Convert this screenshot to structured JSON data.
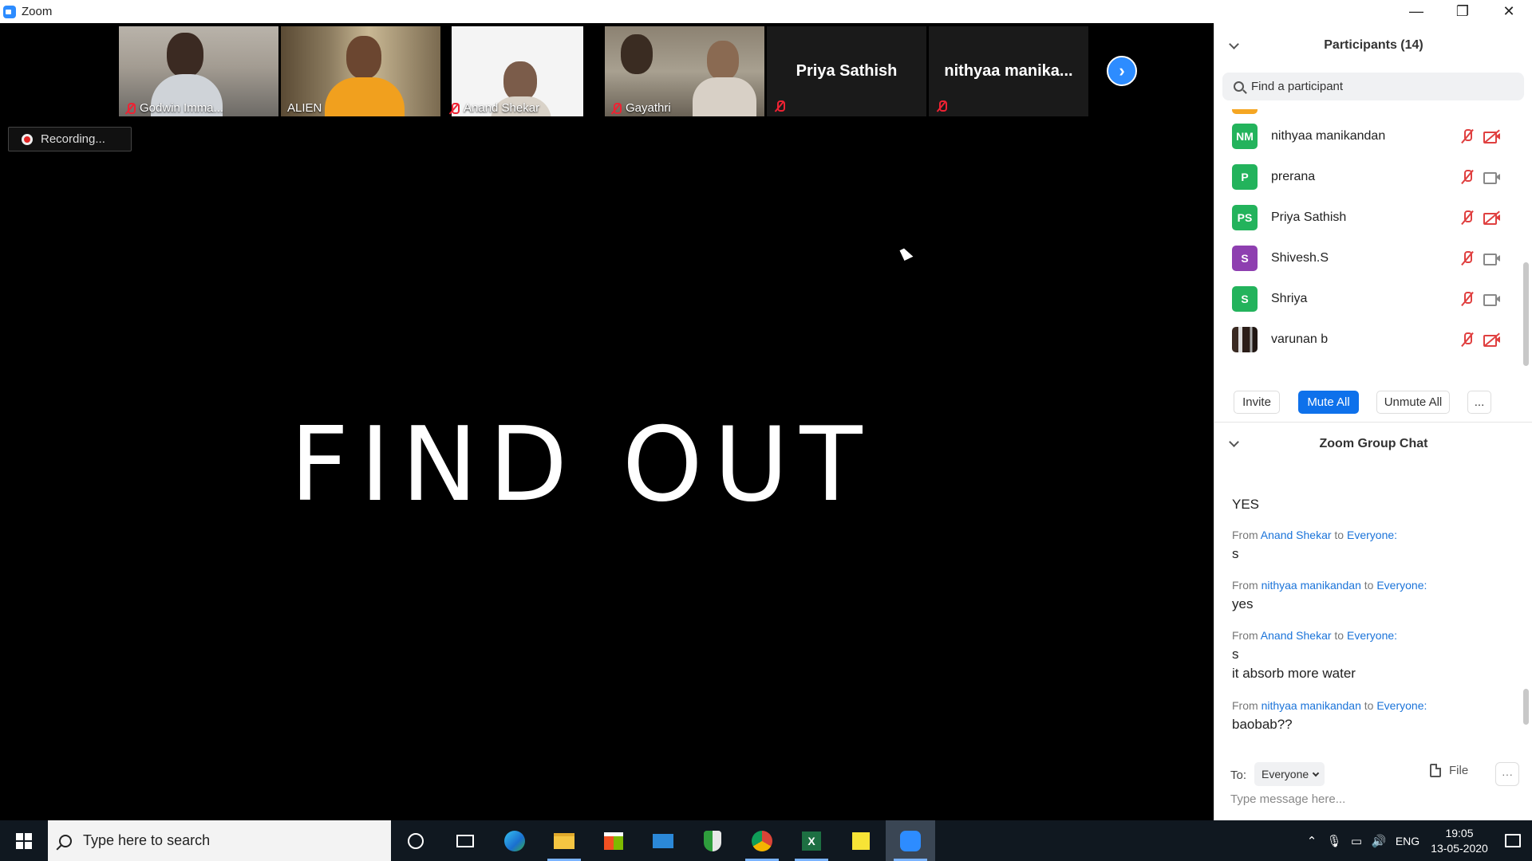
{
  "window": {
    "title": "Zoom",
    "minimize": "—",
    "maximize": "❐",
    "close": "✕"
  },
  "stage": {
    "thumbnails": [
      {
        "name": "Godwin Imma...",
        "muted": true,
        "video": true
      },
      {
        "name": "ALIEN",
        "muted": false,
        "video": true,
        "active": true
      },
      {
        "name": "Anand Shekar",
        "muted": true,
        "video": true
      },
      {
        "name": "Gayathri",
        "muted": true,
        "video": true
      },
      {
        "name": "Priya Sathish",
        "muted": true,
        "video": false
      },
      {
        "name": "nithyaa  manika...",
        "muted": true,
        "video": false
      }
    ],
    "next_label": "›",
    "recording_label": "Recording...",
    "share_text": "FIND OUT"
  },
  "participants": {
    "title": "Participants (14)",
    "search_placeholder": "Find a participant",
    "items": [
      {
        "initials": "NM",
        "name": "nithyaa manikandan",
        "color": "#23b35c",
        "mic_muted": true,
        "video_off": true
      },
      {
        "initials": "P",
        "name": "prerana",
        "color": "#23b35c",
        "mic_muted": true,
        "video_off": false
      },
      {
        "initials": "PS",
        "name": "Priya Sathish",
        "color": "#23b35c",
        "mic_muted": true,
        "video_off": true
      },
      {
        "initials": "S",
        "name": "Shivesh.S",
        "color": "#8e3fb0",
        "mic_muted": true,
        "video_off": false
      },
      {
        "initials": "S",
        "name": "Shriya",
        "color": "#23b35c",
        "mic_muted": true,
        "video_off": false
      },
      {
        "initials": "",
        "name": "varunan b",
        "color": "#333333",
        "mic_muted": true,
        "video_off": true,
        "photo": true
      }
    ],
    "buttons": {
      "invite": "Invite",
      "mute_all": "Mute All",
      "unmute_all": "Unmute All",
      "more": "..."
    }
  },
  "chat": {
    "title": "Zoom Group Chat",
    "partial_top": "YES",
    "messages": [
      {
        "from": "Anand Shekar",
        "to": "Everyone:",
        "lines": [
          "s"
        ]
      },
      {
        "from": "nithyaa manikandan",
        "to": "Everyone:",
        "lines": [
          "yes"
        ]
      },
      {
        "from": "Anand Shekar",
        "to": "Everyone:",
        "lines": [
          "s",
          "it absorb more water"
        ]
      },
      {
        "from": "nithyaa manikandan",
        "to": "Everyone:",
        "lines": [
          "baobab??"
        ]
      }
    ],
    "from_word": "From",
    "to_word": "to",
    "to_label": "To:",
    "to_value": "Everyone",
    "file_label": "File",
    "more_label": "···",
    "input_placeholder": "Type message here..."
  },
  "taskbar": {
    "search_placeholder": "Type here to search",
    "language": "ENG",
    "time": "19:05",
    "date": "13-05-2020"
  },
  "colors": {
    "accent": "#0e71eb",
    "muted_red": "#e04040",
    "link_blue": "#1a73d9"
  }
}
